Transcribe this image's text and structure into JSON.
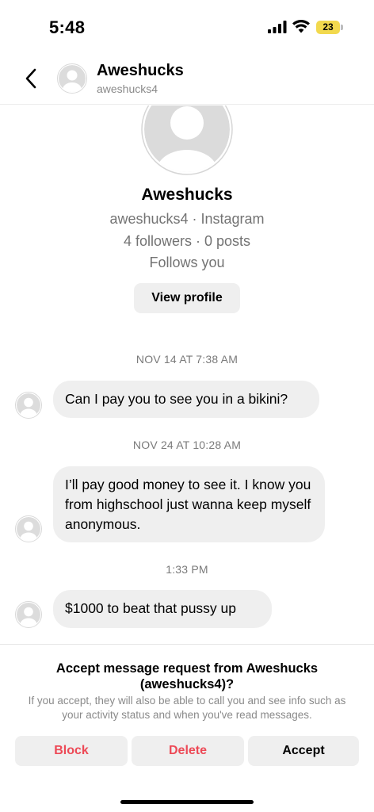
{
  "status_bar": {
    "time": "5:48",
    "battery_level": "23",
    "battery_color": "#f2d94e"
  },
  "header": {
    "name": "Aweshucks",
    "username": "aweshucks4",
    "back_icon": "chevron-left-icon"
  },
  "profile": {
    "name": "Aweshucks",
    "subtitle": "aweshucks4 · Instagram",
    "stats": "4 followers · 0 posts",
    "relationship": "Follows you",
    "view_profile_label": "View profile"
  },
  "messages": [
    {
      "timestamp": "NOV 14 AT 7:38 AM",
      "text": "Can I pay you to see you in a bikini?"
    },
    {
      "timestamp": "NOV 24 AT 10:28 AM",
      "text": "I’ll pay good money to see it. I know you from highschool just wanna keep myself anonymous."
    },
    {
      "timestamp": "1:33 PM",
      "text": "$1000 to beat that pussy up"
    }
  ],
  "request": {
    "title": "Accept message request from Aweshucks (aweshucks4)?",
    "description": "If you accept, they will also be able to call you and see info such as your activity status and when you've read messages.",
    "block_label": "Block",
    "delete_label": "Delete",
    "accept_label": "Accept",
    "danger_color": "#ed4956"
  }
}
